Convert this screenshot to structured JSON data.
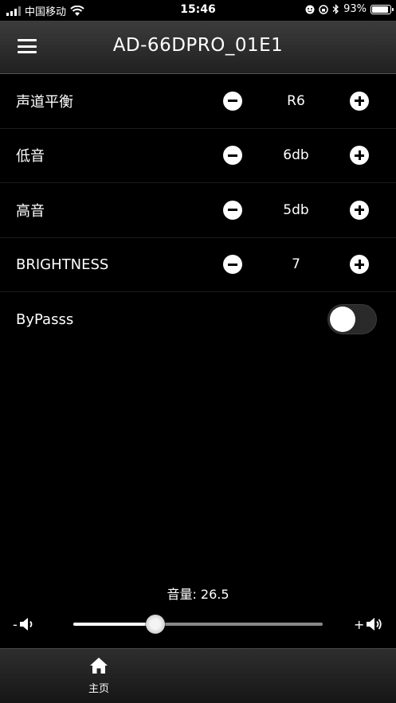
{
  "status_bar": {
    "carrier": "中国移动",
    "time": "15:46",
    "battery_text": "93%",
    "battery_level": 0.93
  },
  "header": {
    "title": "AD-66DPRO_01E1"
  },
  "settings": {
    "rows": [
      {
        "label": "声道平衡",
        "value": "R6"
      },
      {
        "label": "低音",
        "value": "6db"
      },
      {
        "label": "高音",
        "value": "5db"
      },
      {
        "label": "BRIGHTNESS",
        "value": "7"
      }
    ],
    "bypass": {
      "label": "ByPasss",
      "enabled": false
    }
  },
  "volume": {
    "label": "音量: 26.5",
    "level_fraction": 0.33,
    "minus_label": "-",
    "plus_label": "+"
  },
  "bottom_nav": {
    "home_label": "主页"
  },
  "icons": {
    "menu": "hamburger-icon",
    "home": "home-icon",
    "speaker": "speaker-icon",
    "wifi": "wifi-icon"
  }
}
